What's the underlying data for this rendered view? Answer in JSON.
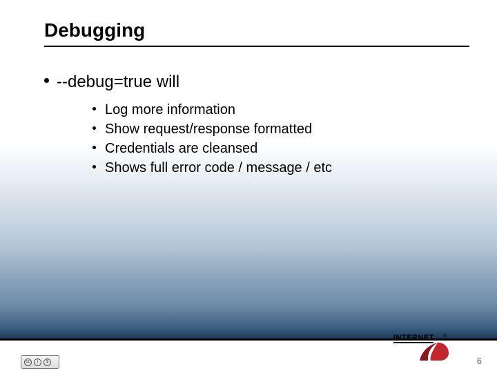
{
  "slide": {
    "title": "Debugging",
    "main_bullet": "--debug=true will",
    "sub_bullets": [
      "Log more information",
      "Show request/response formatted",
      "Credentials are cleansed",
      "Shows full error code / message / etc"
    ],
    "page_number": "6",
    "logo_text_top": "INTERNET",
    "logo_reg": "®",
    "cc_label": "BY   NC"
  }
}
